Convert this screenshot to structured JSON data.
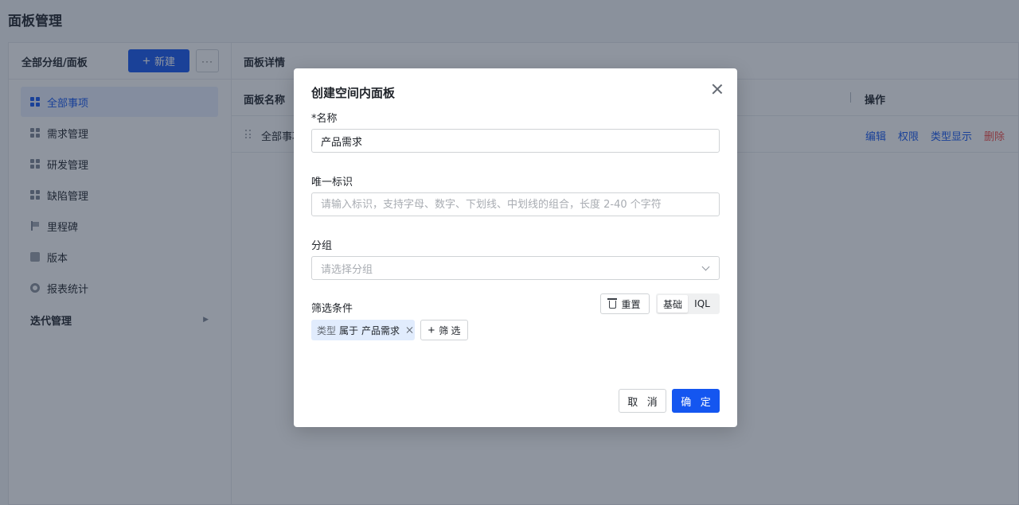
{
  "page": {
    "title": "面板管理"
  },
  "left": {
    "header": "全部分组/面板",
    "new_label": "新建",
    "more_label": "···",
    "items": [
      {
        "label": "全部事项",
        "icon": "grid-icon"
      },
      {
        "label": "需求管理",
        "icon": "grid-icon"
      },
      {
        "label": "研发管理",
        "icon": "grid-icon"
      },
      {
        "label": "缺陷管理",
        "icon": "grid-icon"
      },
      {
        "label": "里程碑",
        "icon": "flag-icon"
      },
      {
        "label": "版本",
        "icon": "version-icon"
      },
      {
        "label": "报表统计",
        "icon": "report-icon"
      }
    ],
    "group": {
      "label": "迭代管理",
      "caret": "▶"
    }
  },
  "right": {
    "header": "面板详情",
    "table": {
      "col_name": "面板名称",
      "col_ops": "操作",
      "rows": [
        {
          "name": "全部事项",
          "ops": [
            "编辑",
            "权限",
            "类型显示",
            "删除"
          ]
        }
      ]
    }
  },
  "modal": {
    "title": "创建空间内面板",
    "name_label": "*名称",
    "name_value": "产品需求",
    "key_label": "唯一标识",
    "key_placeholder": "请输入标识，支持字母、数字、下划线、中划线的组合，长度 2-40 个字符",
    "group_label": "分组",
    "group_placeholder": "请选择分组",
    "filter_label": "筛选条件",
    "reset_label": "重置",
    "mode_basic": "基础",
    "mode_iql": "IQL",
    "filter_tag": {
      "key": "类型",
      "op": "属于",
      "value": "产品需求"
    },
    "add_filter_label": "筛 选",
    "cancel_label": "取 消",
    "ok_label": "确 定"
  },
  "colors": {
    "primary": "#1456f0",
    "danger": "#f54a45",
    "overlay": "rgba(31,43,64,0.5)"
  }
}
